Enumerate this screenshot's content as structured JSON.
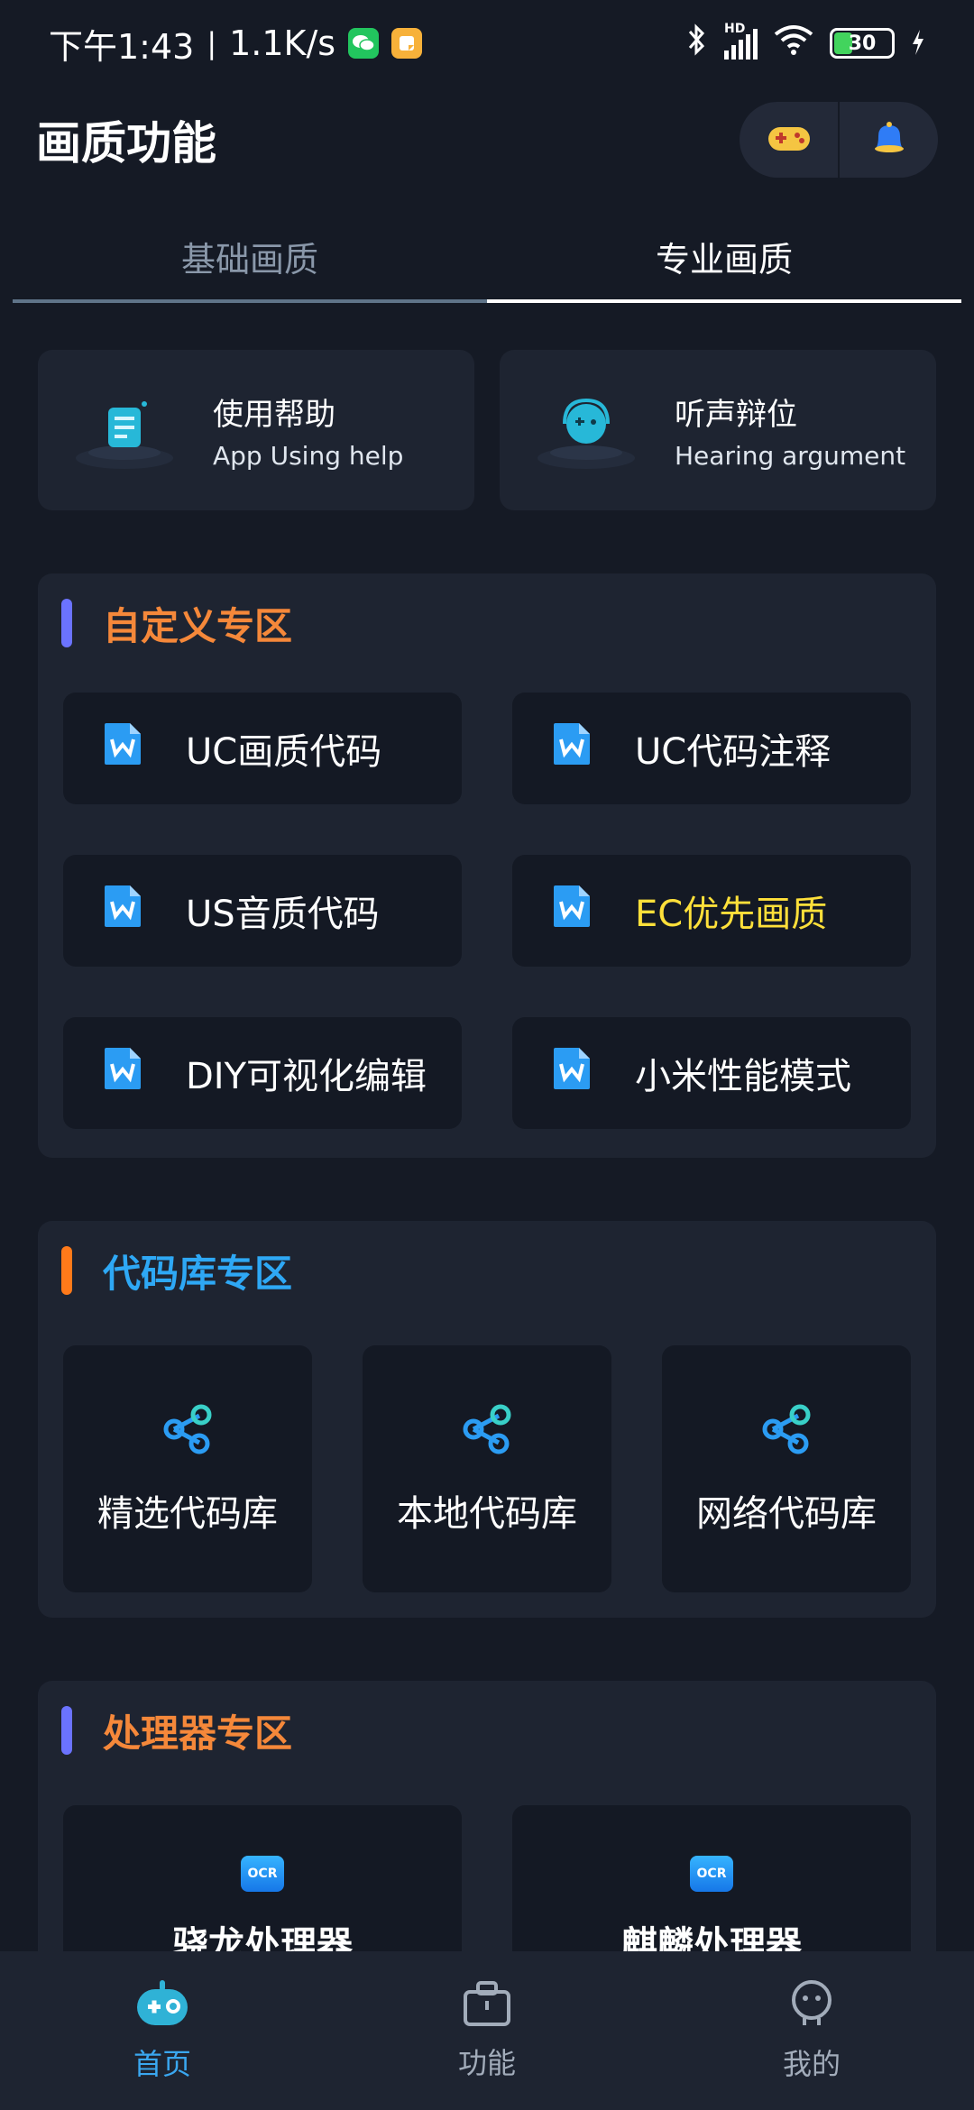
{
  "status_bar": {
    "time": "下午1:43",
    "speed": "1.1K/s",
    "battery": "30",
    "network": "HD"
  },
  "header": {
    "title": "画质功能",
    "actions": [
      "gamepad-icon",
      "bell-icon"
    ]
  },
  "tabs": [
    {
      "label": "基础画质",
      "active": false
    },
    {
      "label": "专业画质",
      "active": true
    }
  ],
  "help_cards": [
    {
      "title": "使用帮助",
      "subtitle": "App Using help"
    },
    {
      "title": "听声辩位",
      "subtitle": "Hearing argument"
    }
  ],
  "sections": {
    "custom": {
      "title": "自定义专区",
      "title_color": "#f5883a",
      "bar_color": "#6b73ff",
      "items": [
        {
          "label": "UC画质代码",
          "color": "#ffffff"
        },
        {
          "label": "UC代码注释",
          "color": "#ffffff"
        },
        {
          "label": "US音质代码",
          "color": "#ffffff"
        },
        {
          "label": "EC优先画质",
          "color": "#ffe03a"
        },
        {
          "label": "DIY可视化编辑",
          "color": "#ffffff"
        },
        {
          "label": "小米性能模式",
          "color": "#ffffff"
        }
      ]
    },
    "library": {
      "title": "代码库专区",
      "title_color": "#2ea8f5",
      "bar_color": "#ff7a1a",
      "items": [
        "精选代码库",
        "本地代码库",
        "网络代码库"
      ]
    },
    "processor": {
      "title": "处理器专区",
      "title_color": "#f5883a",
      "bar_color": "#6b73ff",
      "items": [
        "骁龙处理器",
        "麒麟处理器"
      ],
      "icon_text": "OCR"
    }
  },
  "bottom_nav": [
    {
      "label": "首页",
      "active": true
    },
    {
      "label": "功能",
      "active": false
    },
    {
      "label": "我的",
      "active": false
    }
  ]
}
